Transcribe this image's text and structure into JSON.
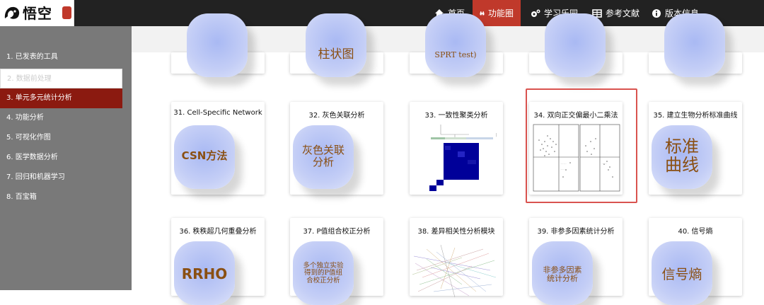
{
  "topbar": {
    "logo_text": "悟空",
    "nav": [
      {
        "label": "首页",
        "icon": "home-icon"
      },
      {
        "label": "功能圈",
        "icon": "binoculars-icon",
        "active": true
      },
      {
        "label": "学习乐园",
        "icon": "gears-icon"
      },
      {
        "label": "参考文献",
        "icon": "table-icon"
      },
      {
        "label": "版本信息",
        "icon": "info-icon"
      }
    ]
  },
  "sidebar": {
    "items": [
      {
        "label": "1. 已发表的工具"
      },
      {
        "label": "2. 数据前处理"
      },
      {
        "label": "3. 单元多元统计分析"
      },
      {
        "label": "4. 功能分析"
      },
      {
        "label": "5. 可视化作图"
      },
      {
        "label": "6. 医学数据分析"
      },
      {
        "label": "7. 回归和机器学习"
      },
      {
        "label": "8. 百宝箱"
      }
    ]
  },
  "top_row_partial": [
    "柱状图",
    "SPRT test)"
  ],
  "cards": [
    {
      "title": "31. Cell-Specific Network",
      "blob_text": "CSN方法"
    },
    {
      "title": "32. 灰色关联分析",
      "blob_text": "灰色关联\n分析"
    },
    {
      "title": "33. 一致性聚类分析",
      "blob_text": ""
    },
    {
      "title": "34. 双向正交偏最小二乘法",
      "blob_text": "",
      "selected": true
    },
    {
      "title": "35. 建立生物分析标准曲线",
      "blob_text": "标准\n曲线"
    },
    {
      "title": "36. 秩秩超几何重叠分析",
      "blob_text": "RRHO"
    },
    {
      "title": "37. P值组合校正分析",
      "blob_text": "多个独立实验\n得到的P值组\n合校正分析"
    },
    {
      "title": "38. 差异相关性分析模块",
      "blob_text": ""
    },
    {
      "title": "39. 非参多因素统计分析",
      "blob_text": "非参多因素\n统计分析"
    },
    {
      "title": "40. 信号熵",
      "blob_text": "信号熵"
    }
  ],
  "colors": {
    "topbar": "#222222",
    "accent": "#c0392b",
    "sidebar": "#797979",
    "sidebar_active": "#8b1a10",
    "blob": "#b8c5f5",
    "blob_text": "#8a4f12",
    "heatmap": "#000099"
  }
}
